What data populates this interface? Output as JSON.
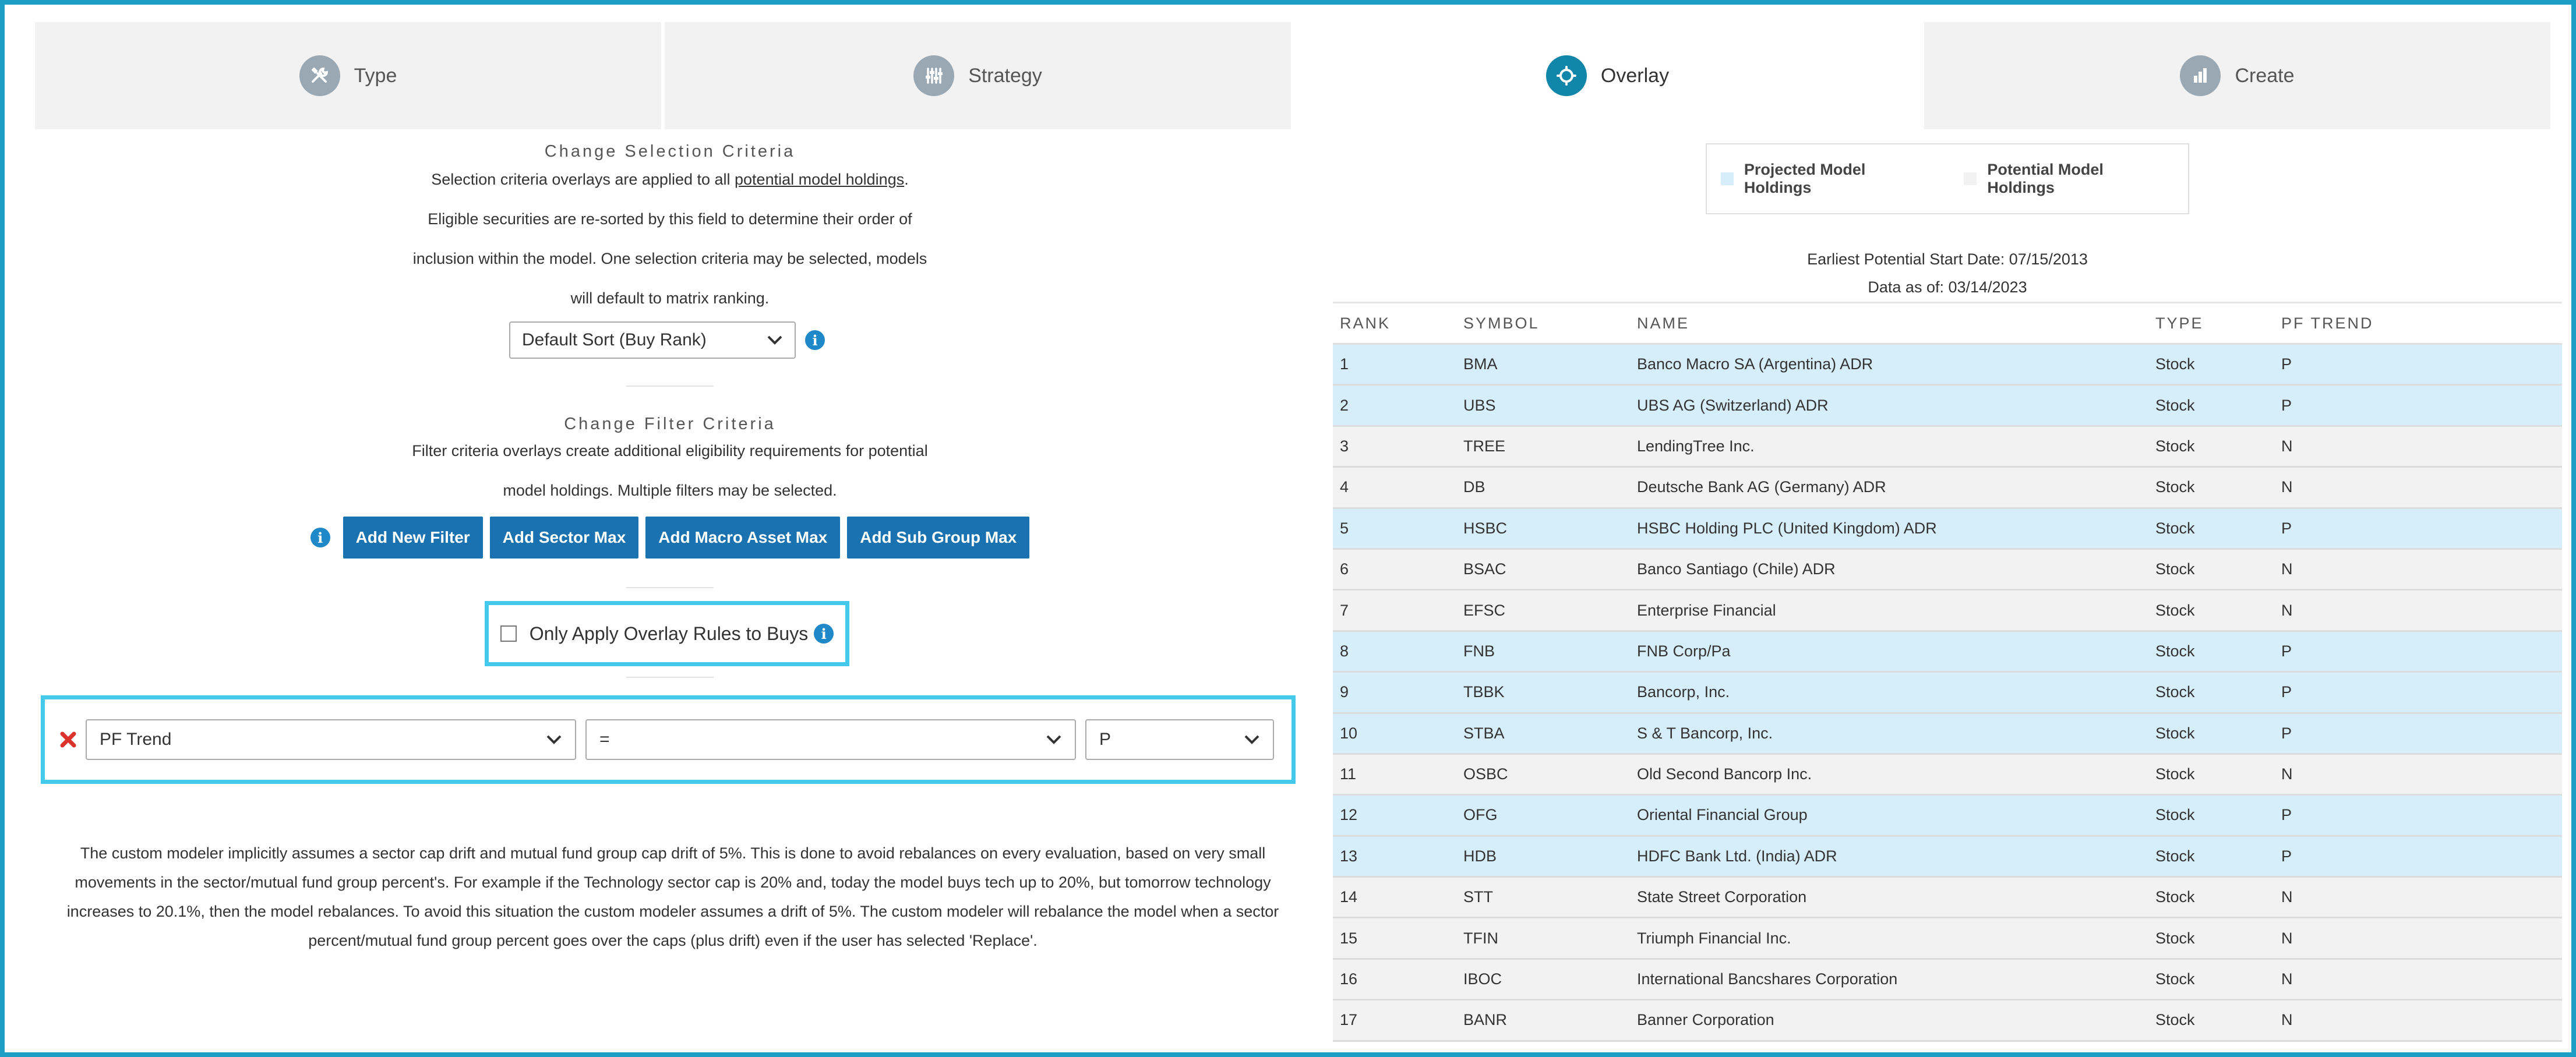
{
  "tabs": [
    {
      "label": "Type",
      "icon": "tools-icon",
      "active": false
    },
    {
      "label": "Strategy",
      "icon": "sliders-icon",
      "active": false
    },
    {
      "label": "Overlay",
      "icon": "overlay-icon",
      "active": true
    },
    {
      "label": "Create",
      "icon": "bar-chart-icon",
      "active": false
    }
  ],
  "selection": {
    "title": "Change Selection Criteria",
    "line1_pre": "Selection criteria overlays are applied to all ",
    "line1_link": "potential model holdings",
    "line1_post": ".",
    "line2": "Eligible securities are re-sorted by this field to determine their order of",
    "line3": "inclusion within the model. One selection criteria may be selected, models",
    "line4": "will default to matrix ranking.",
    "sort_value": "Default Sort (Buy Rank)"
  },
  "filter": {
    "title": "Change Filter Criteria",
    "line1": "Filter criteria overlays create additional eligibility requirements for potential",
    "line2": "model holdings. Multiple filters may be selected.",
    "buttons": {
      "add_new_filter": "Add New Filter",
      "add_sector_max": "Add Sector Max",
      "add_macro_asset_max": "Add Macro Asset Max",
      "add_sub_group_max": "Add Sub Group Max"
    }
  },
  "overlay_buys": {
    "label": "Only Apply Overlay Rules to Buys",
    "checked": false
  },
  "rule": {
    "field": "PF Trend",
    "operator": "=",
    "value": "P"
  },
  "disclaimer": {
    "line1": "The custom modeler implicitly assumes a sector cap drift and mutual fund group cap drift of 5%. This is done to avoid rebalances on every evaluation, based on very small",
    "line2": "movements in the sector/mutual fund group percent's. For example if the Technology sector cap is 20% and, today the model buys tech up to 20%, but tomorrow technology",
    "line3": "increases to 20.1%, then the model rebalances. To avoid this situation the custom modeler assumes a drift of 5%. The custom modeler will rebalance the model when a sector",
    "line4": "percent/mutual fund group percent goes over the caps (plus drift) even if the user has selected 'Replace'."
  },
  "legend": {
    "projected": "Projected Model Holdings",
    "potential": "Potential Model Holdings",
    "projected_color": "#d6eefa",
    "potential_color": "#f2f2f2"
  },
  "meta": {
    "start_date": "Earliest Potential Start Date: 07/15/2013",
    "data_as_of": "Data as of: 03/14/2023"
  },
  "table": {
    "headers": [
      "RANK",
      "SYMBOL",
      "NAME",
      "TYPE",
      "PF TREND"
    ],
    "rows": [
      {
        "rank": "1",
        "symbol": "BMA",
        "name": "Banco Macro SA (Argentina) ADR",
        "type": "Stock",
        "trend": "P",
        "projected": true
      },
      {
        "rank": "2",
        "symbol": "UBS",
        "name": "UBS AG (Switzerland) ADR",
        "type": "Stock",
        "trend": "P",
        "projected": true
      },
      {
        "rank": "3",
        "symbol": "TREE",
        "name": "LendingTree Inc.",
        "type": "Stock",
        "trend": "N",
        "projected": false
      },
      {
        "rank": "4",
        "symbol": "DB",
        "name": "Deutsche Bank AG (Germany) ADR",
        "type": "Stock",
        "trend": "N",
        "projected": false
      },
      {
        "rank": "5",
        "symbol": "HSBC",
        "name": "HSBC Holding PLC (United Kingdom) ADR",
        "type": "Stock",
        "trend": "P",
        "projected": true
      },
      {
        "rank": "6",
        "symbol": "BSAC",
        "name": "Banco Santiago (Chile) ADR",
        "type": "Stock",
        "trend": "N",
        "projected": false
      },
      {
        "rank": "7",
        "symbol": "EFSC",
        "name": "Enterprise Financial",
        "type": "Stock",
        "trend": "N",
        "projected": false
      },
      {
        "rank": "8",
        "symbol": "FNB",
        "name": "FNB Corp/Pa",
        "type": "Stock",
        "trend": "P",
        "projected": true
      },
      {
        "rank": "9",
        "symbol": "TBBK",
        "name": "Bancorp, Inc.",
        "type": "Stock",
        "trend": "P",
        "projected": true
      },
      {
        "rank": "10",
        "symbol": "STBA",
        "name": "S & T Bancorp, Inc.",
        "type": "Stock",
        "trend": "P",
        "projected": true
      },
      {
        "rank": "11",
        "symbol": "OSBC",
        "name": "Old Second Bancorp Inc.",
        "type": "Stock",
        "trend": "N",
        "projected": false
      },
      {
        "rank": "12",
        "symbol": "OFG",
        "name": "Oriental Financial Group",
        "type": "Stock",
        "trend": "P",
        "projected": true
      },
      {
        "rank": "13",
        "symbol": "HDB",
        "name": "HDFC Bank Ltd. (India) ADR",
        "type": "Stock",
        "trend": "P",
        "projected": true
      },
      {
        "rank": "14",
        "symbol": "STT",
        "name": "State Street Corporation",
        "type": "Stock",
        "trend": "N",
        "projected": false
      },
      {
        "rank": "15",
        "symbol": "TFIN",
        "name": "Triumph Financial Inc.",
        "type": "Stock",
        "trend": "N",
        "projected": false
      },
      {
        "rank": "16",
        "symbol": "IBOC",
        "name": "International Bancshares Corporation",
        "type": "Stock",
        "trend": "N",
        "projected": false
      },
      {
        "rank": "17",
        "symbol": "BANR",
        "name": "Banner Corporation",
        "type": "Stock",
        "trend": "N",
        "projected": false
      }
    ]
  }
}
